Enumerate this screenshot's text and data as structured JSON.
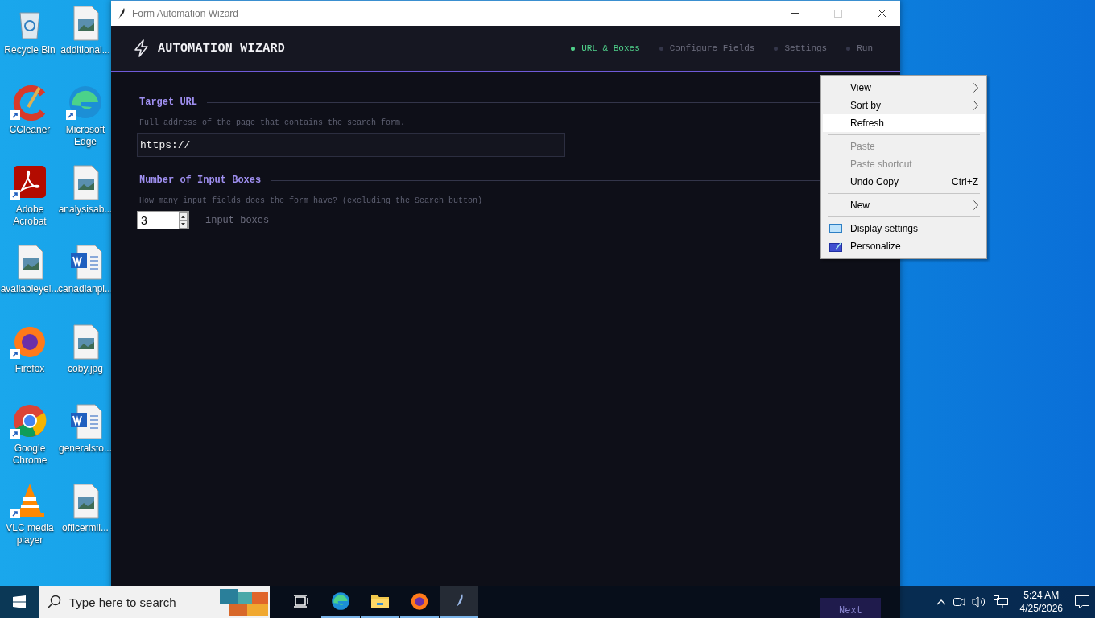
{
  "desktop_icons": [
    {
      "label": "Recycle Bin",
      "kind": "recycle",
      "shortcut": false
    },
    {
      "label": "additional...",
      "kind": "image",
      "shortcut": false
    },
    {
      "label": "CCleaner",
      "kind": "ccleaner",
      "shortcut": true
    },
    {
      "label": "Microsoft Edge",
      "kind": "edge",
      "shortcut": true
    },
    {
      "label": "Adobe Acrobat",
      "kind": "acrobat",
      "shortcut": true
    },
    {
      "label": "analysisab...",
      "kind": "image",
      "shortcut": false
    },
    {
      "label": "availableyel...",
      "kind": "image",
      "shortcut": false
    },
    {
      "label": "canadianpi...",
      "kind": "word",
      "shortcut": false
    },
    {
      "label": "Firefox",
      "kind": "firefox",
      "shortcut": true
    },
    {
      "label": "coby.jpg",
      "kind": "image",
      "shortcut": false
    },
    {
      "label": "Google Chrome",
      "kind": "chrome",
      "shortcut": true
    },
    {
      "label": "generalsto...",
      "kind": "word",
      "shortcut": false
    },
    {
      "label": "VLC media player",
      "kind": "vlc",
      "shortcut": true
    },
    {
      "label": "officermil...",
      "kind": "image",
      "shortcut": false
    }
  ],
  "window": {
    "title": "Form Automation Wizard",
    "header": {
      "title": "AUTOMATION WIZARD",
      "steps": [
        {
          "label": "URL & Boxes",
          "selected": true
        },
        {
          "label": "Configure Fields",
          "selected": false
        },
        {
          "label": "Settings",
          "selected": false
        },
        {
          "label": "Run",
          "selected": false
        }
      ]
    },
    "sections": [
      {
        "heading": "Target URL",
        "hint": "Full address of the page that contains the search form.",
        "kind": "text",
        "value": "https://"
      },
      {
        "heading": "Number of Input Boxes",
        "hint": "How many input fields does the form have? (excluding the Search button)",
        "kind": "spin",
        "value": "3",
        "suffix": "input boxes"
      }
    ],
    "next_button": "Next"
  },
  "context_menu": [
    {
      "label": "View",
      "kind": "submenu",
      "disabled": false,
      "selected": false
    },
    {
      "label": "Sort by",
      "kind": "submenu",
      "disabled": false,
      "selected": false
    },
    {
      "label": "Refresh",
      "kind": "item",
      "disabled": false,
      "selected": true
    },
    {
      "kind": "separator"
    },
    {
      "label": "Paste",
      "kind": "item",
      "disabled": true,
      "selected": false
    },
    {
      "label": "Paste shortcut",
      "kind": "item",
      "disabled": true,
      "selected": false
    },
    {
      "label": "Undo Copy",
      "kind": "item",
      "disabled": false,
      "selected": false,
      "shortcut": "Ctrl+Z"
    },
    {
      "kind": "separator"
    },
    {
      "label": "New",
      "kind": "submenu",
      "disabled": false,
      "selected": false
    },
    {
      "kind": "separator"
    },
    {
      "label": "Display settings",
      "kind": "display",
      "disabled": false,
      "selected": false
    },
    {
      "label": "Personalize",
      "kind": "personalize",
      "disabled": false,
      "selected": false
    }
  ],
  "taskbar": {
    "search_placeholder": "Type here to search",
    "apps": [
      {
        "kind": "taskview",
        "running": false
      },
      {
        "kind": "edge",
        "running": true
      },
      {
        "kind": "explorer",
        "running": true
      },
      {
        "kind": "firefox",
        "running": true
      },
      {
        "kind": "feather",
        "running": true,
        "selected": true
      }
    ],
    "time": "5:24 AM",
    "date": "4/25/2026"
  }
}
